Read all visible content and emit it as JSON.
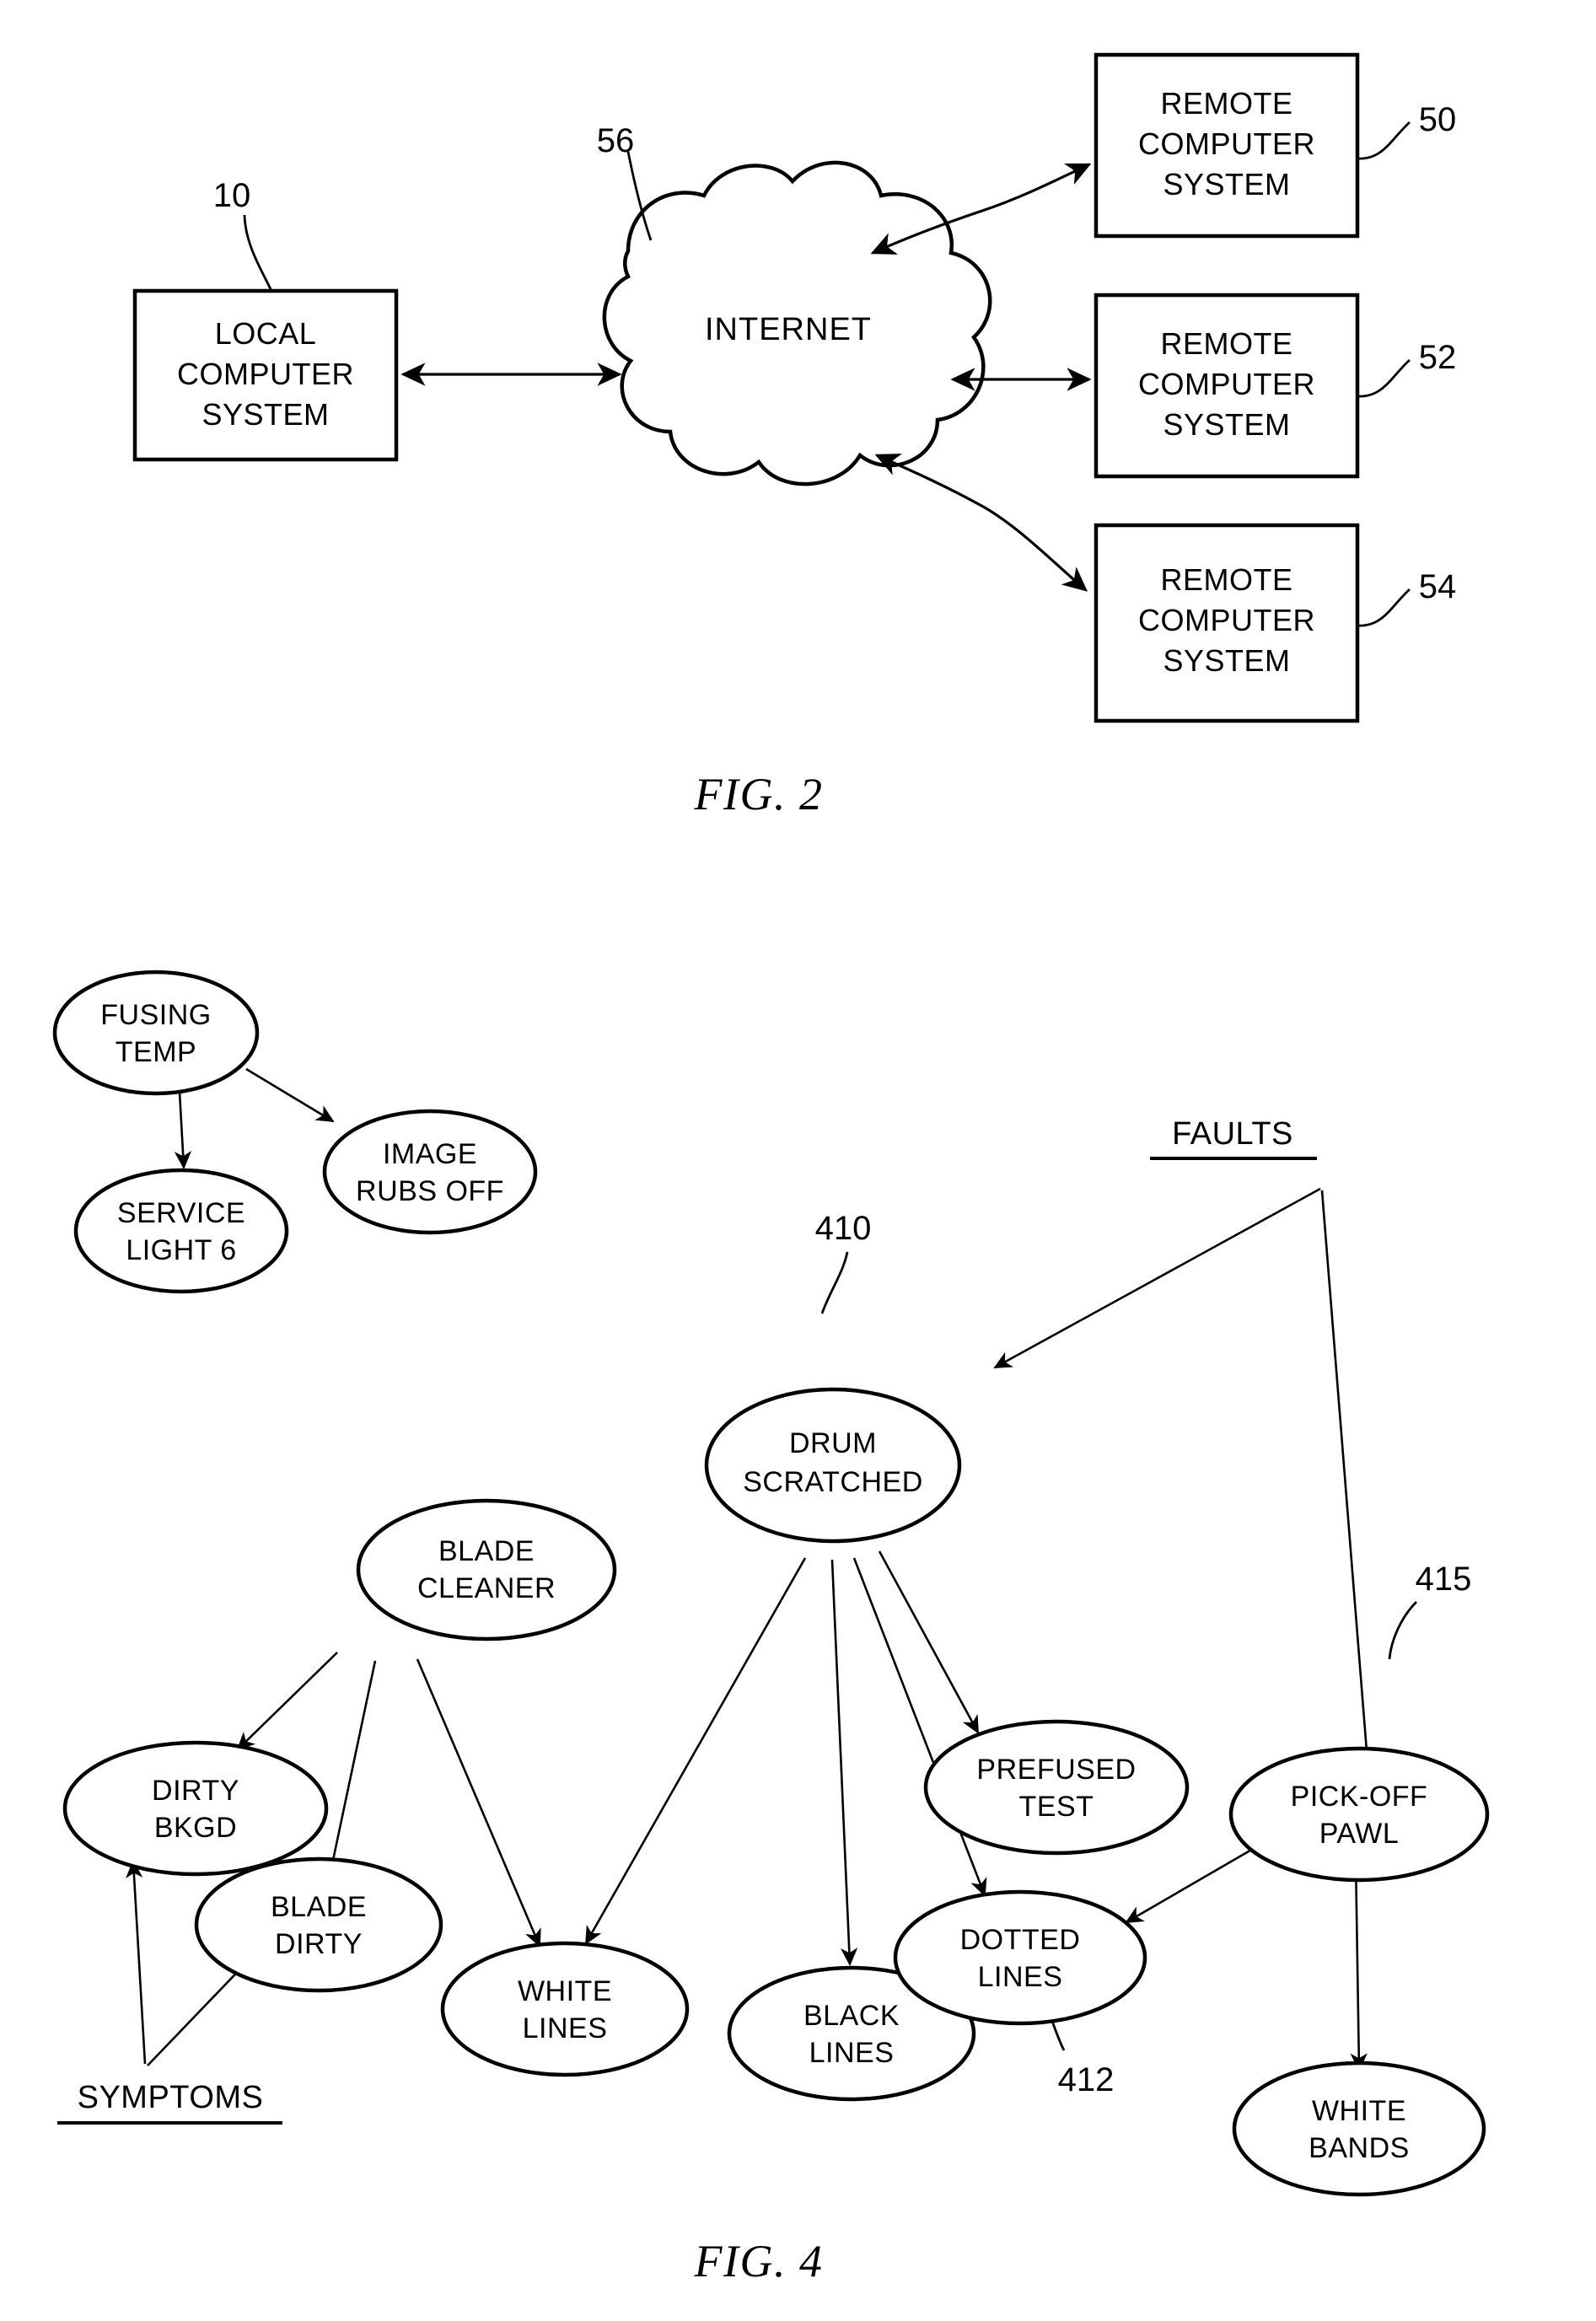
{
  "figures": [
    {
      "id": "fig2",
      "caption": "FIG. 2",
      "nodes": {
        "local": {
          "lines": [
            "LOCAL",
            "COMPUTER",
            "SYSTEM"
          ],
          "ref": "10"
        },
        "internet": {
          "label": "INTERNET",
          "ref": "56"
        },
        "remote1": {
          "lines": [
            "REMOTE",
            "COMPUTER",
            "SYSTEM"
          ],
          "ref": "50"
        },
        "remote2": {
          "lines": [
            "REMOTE",
            "COMPUTER",
            "SYSTEM"
          ],
          "ref": "52"
        },
        "remote3": {
          "lines": [
            "REMOTE",
            "COMPUTER",
            "SYSTEM"
          ],
          "ref": "54"
        }
      }
    },
    {
      "id": "fig4",
      "caption": "FIG. 4",
      "group_labels": {
        "faults": "FAULTS",
        "symptoms": "SYMPTOMS"
      },
      "ref_nums": {
        "drum": "410",
        "dotted": "412",
        "pawl": "415"
      },
      "nodes": {
        "fusing_temp": {
          "lines": [
            "FUSING",
            "TEMP"
          ]
        },
        "image_rubs_off": {
          "lines": [
            "IMAGE",
            "RUBS OFF"
          ]
        },
        "service_light": {
          "lines": [
            "SERVICE",
            "LIGHT 6"
          ]
        },
        "drum_scratched": {
          "lines": [
            "DRUM",
            "SCRATCHED"
          ]
        },
        "blade_cleaner": {
          "lines": [
            "BLADE",
            "CLEANER"
          ]
        },
        "dirty_bkgd": {
          "lines": [
            "DIRTY",
            "BKGD"
          ]
        },
        "blade_dirty": {
          "lines": [
            "BLADE",
            "DIRTY"
          ]
        },
        "prefused_test": {
          "lines": [
            "PREFUSED",
            "TEST"
          ]
        },
        "pick_off_pawl": {
          "lines": [
            "PICK-OFF",
            "PAWL"
          ]
        },
        "white_lines": {
          "lines": [
            "WHITE",
            "LINES"
          ]
        },
        "black_lines": {
          "lines": [
            "BLACK",
            "LINES"
          ]
        },
        "dotted_lines": {
          "lines": [
            "DOTTED",
            "LINES"
          ]
        },
        "white_bands": {
          "lines": [
            "WHITE",
            "BANDS"
          ]
        }
      },
      "edges": [
        {
          "from": "fusing_temp",
          "to": "service_light"
        },
        {
          "from": "fusing_temp",
          "to": "image_rubs_off"
        },
        {
          "from": "faults",
          "to": "drum_scratched"
        },
        {
          "from": "faults",
          "to": "pick_off_pawl"
        },
        {
          "from": "drum_scratched",
          "to": "white_lines"
        },
        {
          "from": "drum_scratched",
          "to": "black_lines"
        },
        {
          "from": "drum_scratched",
          "to": "dotted_lines"
        },
        {
          "from": "drum_scratched",
          "to": "prefused_test"
        },
        {
          "from": "blade_cleaner",
          "to": "dirty_bkgd"
        },
        {
          "from": "blade_cleaner",
          "to": "blade_dirty"
        },
        {
          "from": "blade_cleaner",
          "to": "white_lines"
        },
        {
          "from": "pick_off_pawl",
          "to": "dotted_lines"
        },
        {
          "from": "pick_off_pawl",
          "to": "white_bands"
        },
        {
          "from": "symptoms",
          "to": "dirty_bkgd"
        },
        {
          "from": "symptoms",
          "to": "blade_dirty"
        }
      ]
    }
  ]
}
